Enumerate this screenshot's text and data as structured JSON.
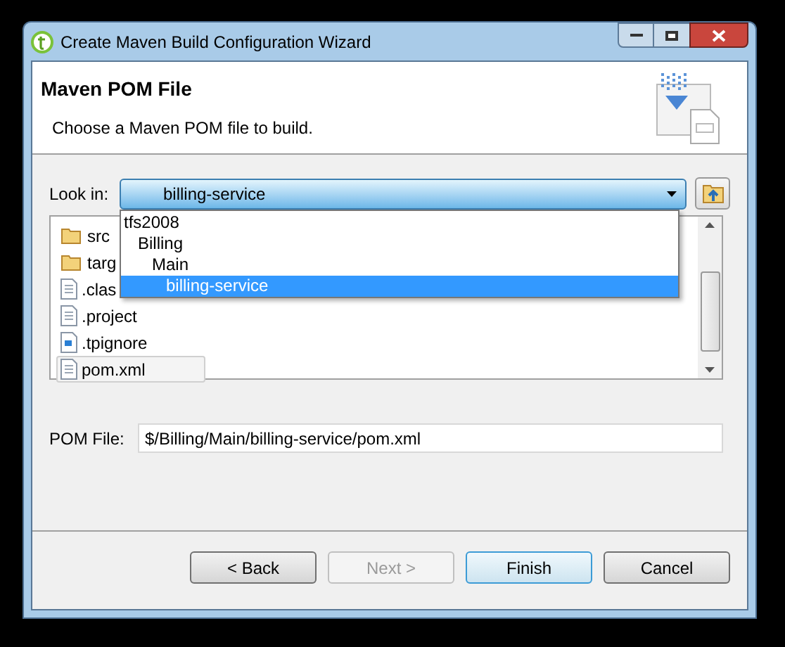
{
  "window": {
    "title": "Create Maven Build Configuration Wizard"
  },
  "header": {
    "title": "Maven POM File",
    "description": "Choose a Maven POM file to build."
  },
  "look_in": {
    "label": "Look in:",
    "value": "billing-service"
  },
  "dropdown": [
    {
      "label": "tfs2008",
      "selected": false,
      "children": [
        {
          "label": "Billing",
          "selected": false,
          "children": [
            {
              "label": "Main",
              "selected": false,
              "children": [
                {
                  "label": "billing-service",
                  "selected": true
                }
              ]
            }
          ]
        }
      ]
    }
  ],
  "files": [
    {
      "name": "src",
      "kind": "folder",
      "selected": false
    },
    {
      "name": "targ",
      "kind": "folder",
      "selected": false
    },
    {
      "name": ".clas",
      "kind": "file",
      "selected": false
    },
    {
      "name": ".project",
      "kind": "file",
      "selected": false
    },
    {
      "name": ".tpignore",
      "kind": "script",
      "selected": false
    },
    {
      "name": "pom.xml",
      "kind": "file",
      "selected": true
    }
  ],
  "pom_file": {
    "label": "POM File:",
    "value": "$/Billing/Main/billing-service/pom.xml"
  },
  "buttons": [
    {
      "label": "< Back",
      "disabled": false,
      "default": false
    },
    {
      "label": "Next >",
      "disabled": true,
      "default": false
    },
    {
      "label": "Finish",
      "disabled": false,
      "default": true
    },
    {
      "label": "Cancel",
      "disabled": false,
      "default": false
    }
  ]
}
